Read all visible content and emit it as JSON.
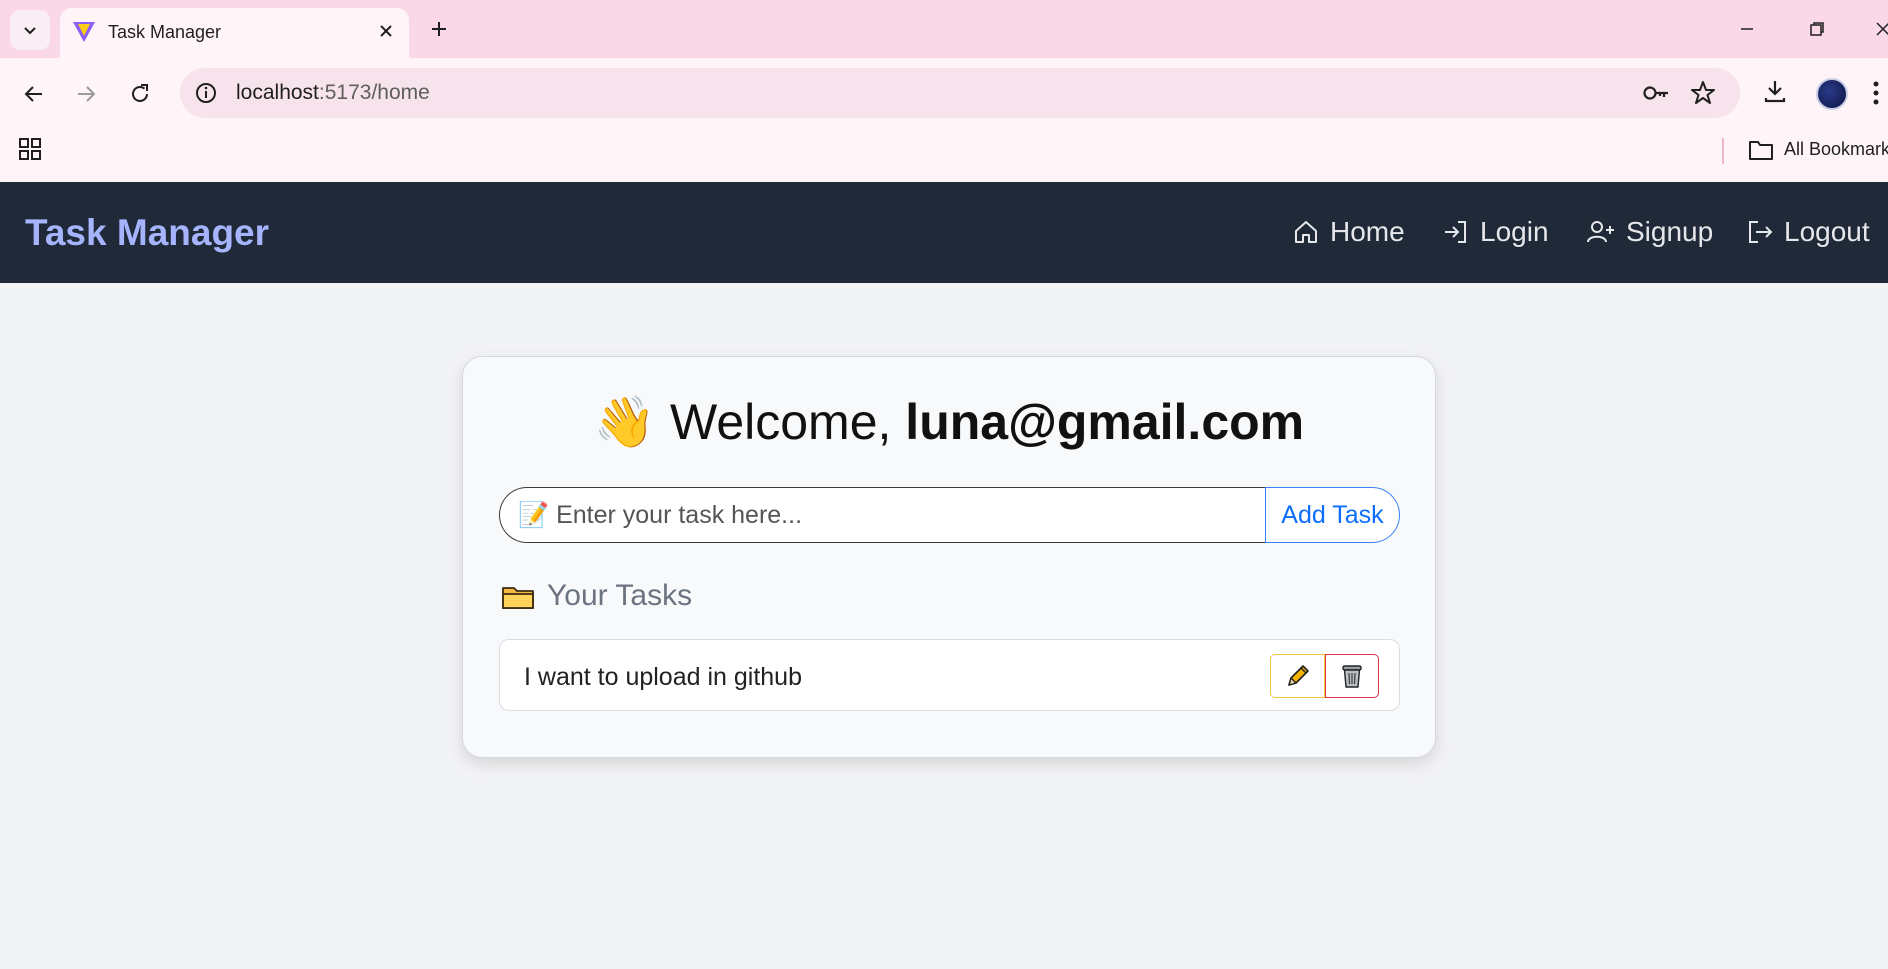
{
  "browser": {
    "tab": {
      "title": "Task Manager"
    },
    "address": {
      "host": "localhost",
      "path": ":5173/home"
    },
    "bookmarks": {
      "all_label": "All Bookmarks"
    }
  },
  "app": {
    "brand": "Task Manager",
    "nav": [
      {
        "label": "Home",
        "icon": "home-icon"
      },
      {
        "label": "Login",
        "icon": "login-icon"
      },
      {
        "label": "Signup",
        "icon": "user-plus-icon"
      },
      {
        "label": "Logout",
        "icon": "logout-icon"
      }
    ],
    "welcome": {
      "emoji": "👋",
      "prefix": "Welcome, ",
      "email": "luna@gmail.com"
    },
    "task_input": {
      "emoji": "📝",
      "placeholder": "Enter your task here...",
      "value": ""
    },
    "add_button": "Add Task",
    "tasks_heading": {
      "emoji": "🗂️",
      "text": "Your Tasks"
    },
    "tasks": [
      {
        "text": "I want to upload in github",
        "edit_icon": "pencil-icon",
        "delete_icon": "trash-icon"
      }
    ]
  },
  "colors": {
    "navbar_bg": "#1f2937",
    "brand": "#a5b4fc",
    "accent_blue": "#0d6efd",
    "edit_border": "#f5c542",
    "delete_border": "#dc3545",
    "tabstrip": "#fbd8e8"
  }
}
